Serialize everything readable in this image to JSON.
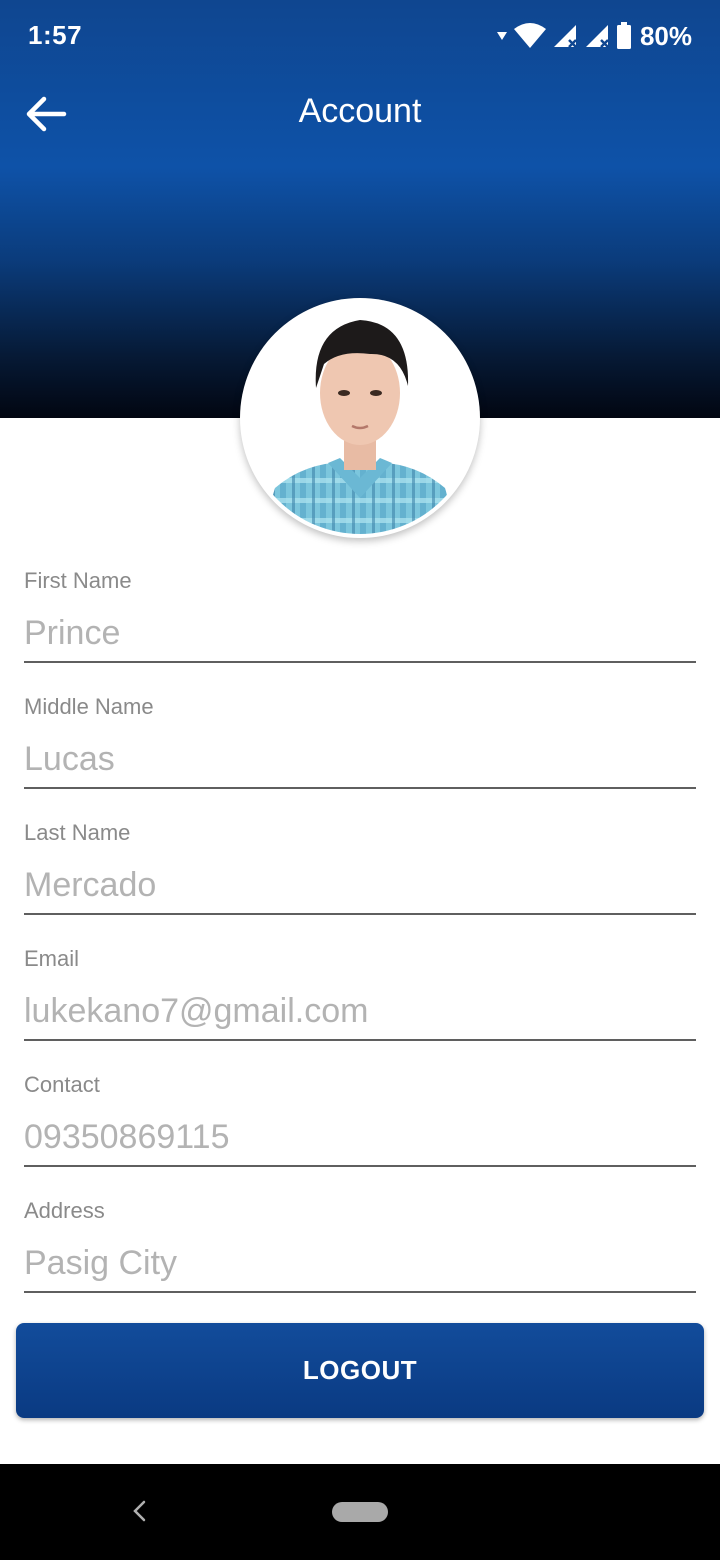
{
  "status_bar": {
    "time": "1:57",
    "battery": "80%",
    "icons": [
      "wifi-icon",
      "signal-icon",
      "signal-icon",
      "battery-icon"
    ]
  },
  "app_bar": {
    "title": "Account",
    "back_icon": "arrow-left-icon"
  },
  "profile": {
    "avatar": "profile-photo"
  },
  "fields": [
    {
      "label": "First Name",
      "value": "Prince"
    },
    {
      "label": "Middle Name",
      "value": "Lucas"
    },
    {
      "label": "Last Name",
      "value": "Mercado"
    },
    {
      "label": "Email",
      "value": "lukekano7@gmail.com"
    },
    {
      "label": "Contact",
      "value": "09350869115"
    },
    {
      "label": "Address",
      "value": "Pasig City"
    }
  ],
  "logout_label": "LOGOUT",
  "colors": {
    "brand": "#0e52a8",
    "button": "#0a3a82",
    "label": "#8a8a8a",
    "value": "#b3b3b3"
  }
}
